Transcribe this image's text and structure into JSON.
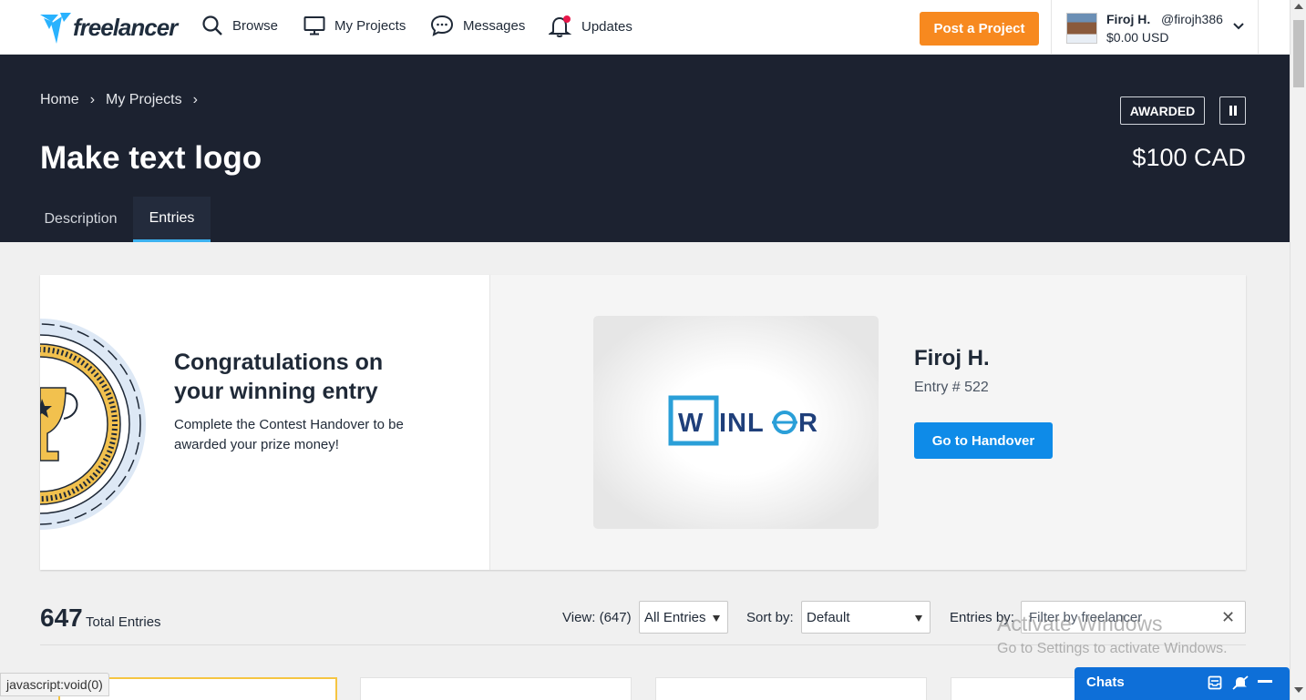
{
  "nav": {
    "logo_text": "freelancer",
    "items": [
      {
        "label": "Browse"
      },
      {
        "label": "My Projects"
      },
      {
        "label": "Messages"
      },
      {
        "label": "Updates"
      }
    ],
    "post_button": "Post a Project",
    "user": {
      "name": "Firoj H.",
      "handle": "@firojh386",
      "balance": "$0.00 USD"
    }
  },
  "header": {
    "breadcrumb": [
      "Home",
      "›",
      "My Projects",
      "›"
    ],
    "title": "Make text logo",
    "status": "AWARDED",
    "prize": "$100 CAD",
    "tabs": [
      {
        "label": "Description"
      },
      {
        "label": "Entries"
      }
    ]
  },
  "winner": {
    "heading": "Congratulations on your winning entry",
    "subtext": "Complete the Contest Handover to be awarded your prize money!",
    "logo_text": "WINLOR",
    "name": "Firoj H.",
    "entry": "Entry # 522",
    "button": "Go to Handover"
  },
  "entries": {
    "total": "647",
    "total_label": "Total Entries",
    "view_label": "View: (647)",
    "view_value": "All Entries",
    "sort_label": "Sort by:",
    "sort_value": "Default",
    "by_label": "Entries by:",
    "filter_placeholder": "Filter by freelancer"
  },
  "status_bar": "javascript:void(0)",
  "watermark": {
    "line1": "Activate Windows",
    "line2": "Go to Settings to activate Windows."
  },
  "chats": {
    "label": "Chats"
  },
  "colors": {
    "accent_orange": "#f7891f",
    "primary_blue": "#0e8be8",
    "header_bg": "#1c2230",
    "tab_underline": "#3db2f0"
  }
}
